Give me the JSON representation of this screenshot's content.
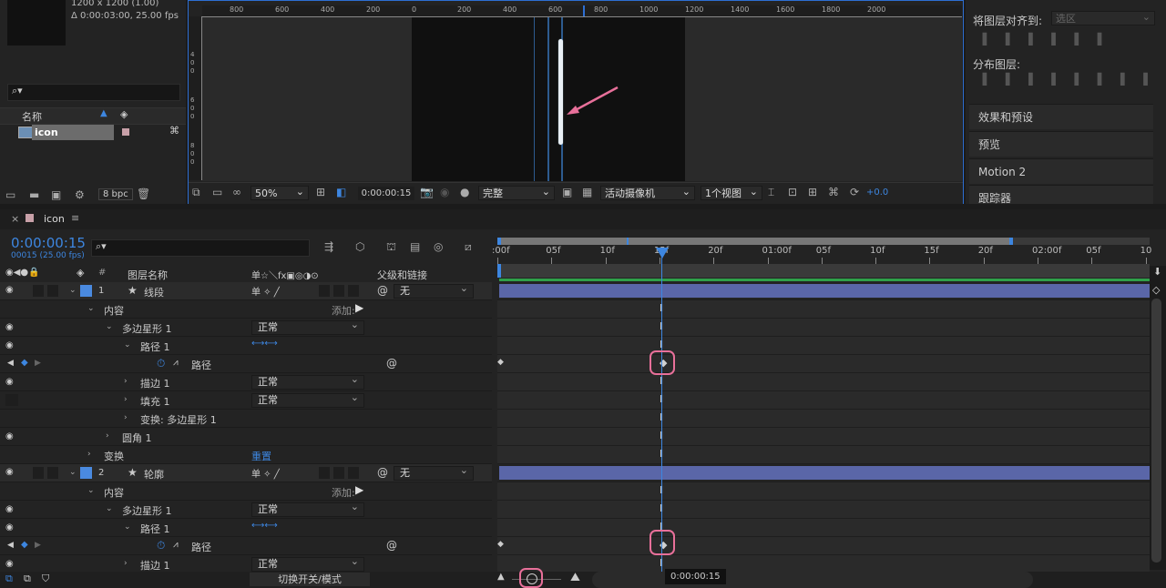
{
  "project": {
    "comp_info_line1": "1200 x 1200 (1.00)",
    "comp_info_line2": "Δ 0:00:03:00, 25.00 fps",
    "search_placeholder": "",
    "col_name": "名称",
    "item_name": "icon",
    "bpc": "8 bpc"
  },
  "viewer": {
    "ruler_labels": [
      "800",
      "600",
      "400",
      "200",
      "0",
      "200",
      "400",
      "600",
      "800",
      "1000",
      "1200",
      "1400",
      "1600",
      "1800",
      "2000"
    ],
    "left_ruler_labels": [
      "4\n0\n0",
      "6\n0\n0",
      "8\n0\n0"
    ],
    "zoom": "50%",
    "timecode": "0:00:00:15",
    "quality": "完整",
    "camera": "活动摄像机",
    "views": "1个视图",
    "exposure": "+0.0"
  },
  "right_panel": {
    "align_to_label": "将图层对齐到:",
    "align_to_value": "选区",
    "distribute_label": "分布图层:",
    "items": [
      "效果和预设",
      "预览",
      "Motion 2",
      "跟踪器"
    ]
  },
  "timeline": {
    "tab_name": "icon",
    "current_time": "0:00:00:15",
    "current_frame": "00015 (25.00 fps)",
    "col_layer_name": "图层名称",
    "col_parent": "父级和链接",
    "col_switches": "单☆＼fx▣◎◑⊙",
    "ruler_labels": [
      ":00f",
      "05f",
      "10f",
      "15f",
      "20f",
      "01:00f",
      "05f",
      "10f",
      "15f",
      "20f",
      "02:00f",
      "05f",
      "10"
    ],
    "toggle_label": "切换开关/模式",
    "time_tooltip": "0:00:00:15",
    "rows": [
      {
        "type": "layer",
        "num": "1",
        "name": "线段",
        "parent": "无"
      },
      {
        "type": "prop",
        "indent": 1,
        "name": "内容",
        "extra": "添加:"
      },
      {
        "type": "prop",
        "indent": 2,
        "name": "多边星形 1",
        "mode": "正常"
      },
      {
        "type": "prop",
        "indent": 3,
        "name": "路径 1"
      },
      {
        "type": "key",
        "indent": 4,
        "name": "路径"
      },
      {
        "type": "prop",
        "indent": 3,
        "name": "描边 1",
        "mode": "正常"
      },
      {
        "type": "prop",
        "indent": 3,
        "name": "填充 1",
        "mode": "正常"
      },
      {
        "type": "prop",
        "indent": 3,
        "name": "变换: 多边星形 1"
      },
      {
        "type": "prop",
        "indent": 2,
        "name": "圆角 1"
      },
      {
        "type": "prop",
        "indent": 1,
        "name": "变换",
        "extra": "重置"
      },
      {
        "type": "layer",
        "num": "2",
        "name": "轮廓",
        "parent": "无"
      },
      {
        "type": "prop",
        "indent": 1,
        "name": "内容",
        "extra": "添加:"
      },
      {
        "type": "prop",
        "indent": 2,
        "name": "多边星形 1",
        "mode": "正常"
      },
      {
        "type": "prop",
        "indent": 3,
        "name": "路径 1"
      },
      {
        "type": "key",
        "indent": 4,
        "name": "路径"
      },
      {
        "type": "prop",
        "indent": 3,
        "name": "描边 1",
        "mode": "正常"
      }
    ]
  }
}
